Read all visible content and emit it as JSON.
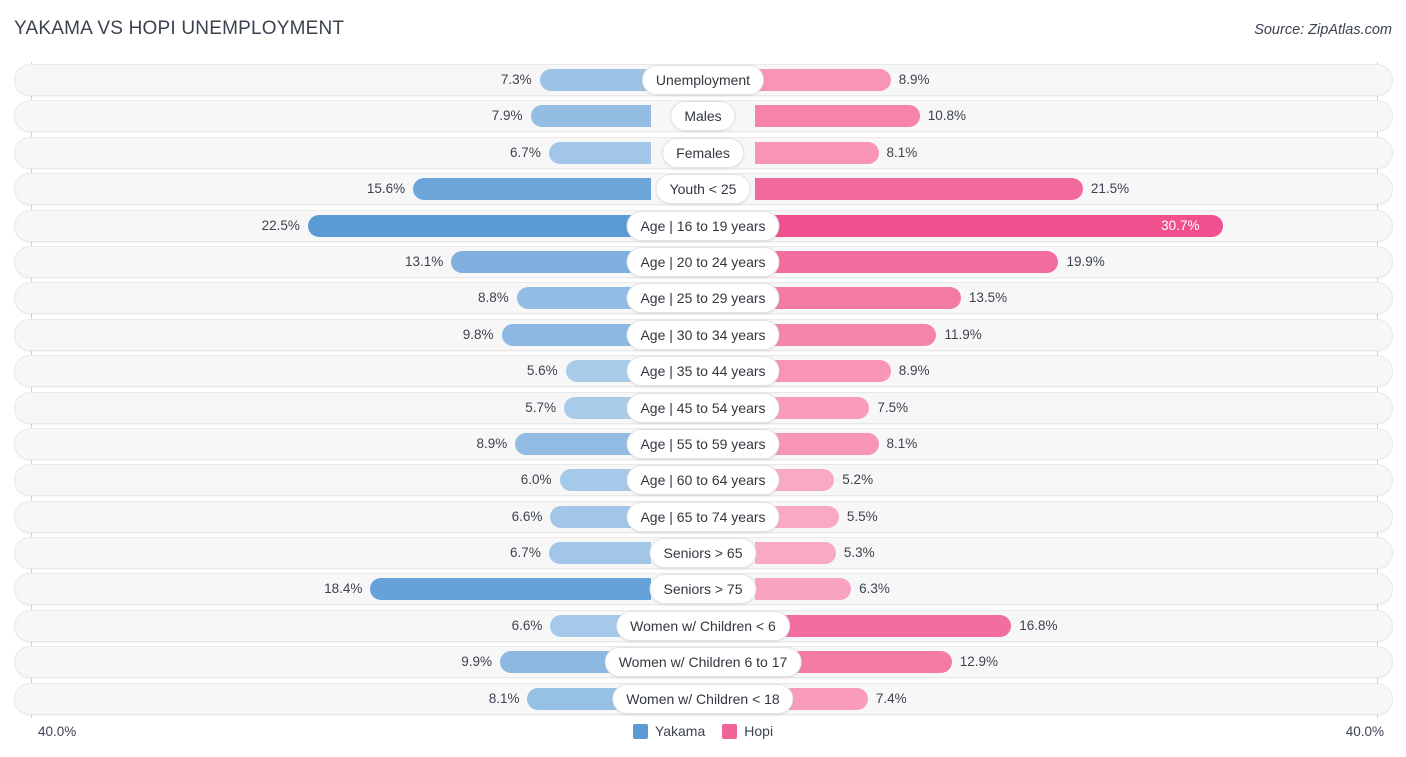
{
  "header": {
    "title": "YAKAMA VS HOPI UNEMPLOYMENT",
    "source": "Source: ZipAtlas.com"
  },
  "legend": {
    "items": [
      {
        "label": "Yakama",
        "color": "#5b9bd5"
      },
      {
        "label": "Hopi",
        "color": "#f2639a"
      }
    ]
  },
  "axis": {
    "left_max_label": "40.0%",
    "right_max_label": "40.0%",
    "max_value": 40.0
  },
  "chart_data": {
    "type": "bar",
    "orientation": "horizontal-diverging",
    "title": "YAKAMA VS HOPI UNEMPLOYMENT",
    "xlabel": "",
    "ylabel": "",
    "xlim": [
      40.0,
      40.0
    ],
    "grid": false,
    "legend_position": "bottom-center",
    "categories": [
      "Unemployment",
      "Males",
      "Females",
      "Youth < 25",
      "Age | 16 to 19 years",
      "Age | 20 to 24 years",
      "Age | 25 to 29 years",
      "Age | 30 to 34 years",
      "Age | 35 to 44 years",
      "Age | 45 to 54 years",
      "Age | 55 to 59 years",
      "Age | 60 to 64 years",
      "Age | 65 to 74 years",
      "Seniors > 65",
      "Seniors > 75",
      "Women w/ Children < 6",
      "Women w/ Children 6 to 17",
      "Women w/ Children < 18"
    ],
    "series": [
      {
        "name": "Yakama",
        "color": "#5b9bd5",
        "values": [
          7.3,
          7.9,
          6.7,
          15.6,
          22.5,
          13.1,
          8.8,
          9.8,
          5.6,
          5.7,
          8.9,
          6.0,
          6.6,
          6.7,
          18.4,
          6.6,
          9.9,
          8.1
        ],
        "labels": [
          "7.3%",
          "7.9%",
          "6.7%",
          "15.6%",
          "22.5%",
          "13.1%",
          "8.8%",
          "9.8%",
          "5.6%",
          "5.7%",
          "8.9%",
          "6.0%",
          "6.6%",
          "6.7%",
          "18.4%",
          "6.6%",
          "9.9%",
          "8.1%"
        ]
      },
      {
        "name": "Hopi",
        "color": "#f2639a",
        "values": [
          8.9,
          10.8,
          8.1,
          21.5,
          30.7,
          19.9,
          13.5,
          11.9,
          8.9,
          7.5,
          8.1,
          5.2,
          5.5,
          5.3,
          6.3,
          16.8,
          12.9,
          7.4
        ],
        "labels": [
          "8.9%",
          "10.8%",
          "8.1%",
          "21.5%",
          "30.7%",
          "19.9%",
          "13.5%",
          "11.9%",
          "8.9%",
          "7.5%",
          "8.1%",
          "5.2%",
          "5.5%",
          "5.3%",
          "6.3%",
          "16.8%",
          "12.9%",
          "7.4%"
        ]
      }
    ]
  },
  "rows": [
    {
      "label": "Unemployment",
      "left_value": 7.3,
      "left_label": "7.3%",
      "left_color": "#9dc3e6",
      "right_value": 8.9,
      "right_label": "8.9%",
      "right_color": "#f794b8",
      "right_label_inside": false
    },
    {
      "label": "Males",
      "left_value": 7.9,
      "left_label": "7.9%",
      "left_color": "#94bde4",
      "right_value": 10.8,
      "right_label": "10.8%",
      "right_color": "#f583ab",
      "right_label_inside": false
    },
    {
      "label": "Females",
      "left_value": 6.7,
      "left_label": "6.7%",
      "left_color": "#a2c6e8",
      "right_value": 8.1,
      "right_label": "8.1%",
      "right_color": "#f794b8",
      "right_label_inside": false
    },
    {
      "label": "Youth < 25",
      "left_value": 15.6,
      "left_label": "15.6%",
      "left_color": "#6ba5da",
      "right_value": 21.5,
      "right_label": "21.5%",
      "right_color": "#f2699e",
      "right_label_inside": false
    },
    {
      "label": "Age | 16 to 19 years",
      "left_value": 22.5,
      "left_label": "22.5%",
      "left_color": "#5b9bd5",
      "right_value": 30.7,
      "right_label": "30.7%",
      "right_color": "#f0508d",
      "right_label_inside": true
    },
    {
      "label": "Age | 20 to 24 years",
      "left_value": 13.1,
      "left_label": "13.1%",
      "left_color": "#7fb0df",
      "right_value": 19.9,
      "right_label": "19.9%",
      "right_color": "#f26c9f",
      "right_label_inside": false
    },
    {
      "label": "Age | 25 to 29 years",
      "left_value": 8.8,
      "left_label": "8.8%",
      "left_color": "#92bce4",
      "right_value": 13.5,
      "right_label": "13.5%",
      "right_color": "#f47ba6",
      "right_label_inside": false
    },
    {
      "label": "Age | 30 to 34 years",
      "left_value": 9.8,
      "left_label": "9.8%",
      "left_color": "#8cb8e2",
      "right_value": 11.9,
      "right_label": "11.9%",
      "right_color": "#f584ac",
      "right_label_inside": false
    },
    {
      "label": "Age | 35 to 44 years",
      "left_value": 5.6,
      "left_label": "5.6%",
      "left_color": "#a8cbea",
      "right_value": 8.9,
      "right_label": "8.9%",
      "right_color": "#f794b8",
      "right_label_inside": false
    },
    {
      "label": "Age | 45 to 54 years",
      "left_value": 5.7,
      "left_label": "5.7%",
      "left_color": "#a8cbea",
      "right_value": 7.5,
      "right_label": "7.5%",
      "right_color": "#f89bbd",
      "right_label_inside": false
    },
    {
      "label": "Age | 55 to 59 years",
      "left_value": 8.9,
      "left_label": "8.9%",
      "left_color": "#92bce4",
      "right_value": 8.1,
      "right_label": "8.1%",
      "right_color": "#f794b8",
      "right_label_inside": false
    },
    {
      "label": "Age | 60 to 64 years",
      "left_value": 6.0,
      "left_label": "6.0%",
      "left_color": "#a5c9e9",
      "right_value": 5.2,
      "right_label": "5.2%",
      "right_color": "#f9a8c6",
      "right_label_inside": false
    },
    {
      "label": "Age | 65 to 74 years",
      "left_value": 6.6,
      "left_label": "6.6%",
      "left_color": "#a2c6e8",
      "right_value": 5.5,
      "right_label": "5.5%",
      "right_color": "#f9a8c6",
      "right_label_inside": false
    },
    {
      "label": "Seniors > 65",
      "left_value": 6.7,
      "left_label": "6.7%",
      "left_color": "#a2c6e8",
      "right_value": 5.3,
      "right_label": "5.3%",
      "right_color": "#f9a8c6",
      "right_label_inside": false
    },
    {
      "label": "Seniors > 75",
      "left_value": 18.4,
      "left_label": "18.4%",
      "left_color": "#66a2d9",
      "right_value": 6.3,
      "right_label": "6.3%",
      "right_color": "#f9a2c2",
      "right_label_inside": false
    },
    {
      "label": "Women w/ Children < 6",
      "left_value": 6.6,
      "left_label": "6.6%",
      "left_color": "#a5c9e9",
      "right_value": 16.8,
      "right_label": "16.8%",
      "right_color": "#f36ea0",
      "right_label_inside": false
    },
    {
      "label": "Women w/ Children 6 to 17",
      "left_value": 9.9,
      "left_label": "9.9%",
      "left_color": "#8cb8e2",
      "right_value": 12.9,
      "right_label": "12.9%",
      "right_color": "#f47ba6",
      "right_label_inside": false
    },
    {
      "label": "Women w/ Children < 18",
      "left_value": 8.1,
      "left_label": "8.1%",
      "left_color": "#97c0e5",
      "right_value": 7.4,
      "right_label": "7.4%",
      "right_color": "#f89bbd",
      "right_label_inside": false
    }
  ]
}
